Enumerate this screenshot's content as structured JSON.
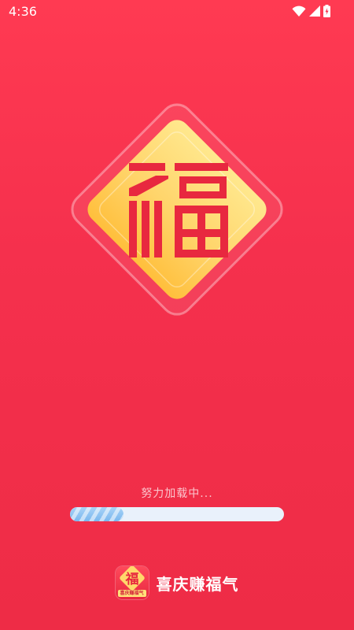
{
  "status_bar": {
    "time": "4:36",
    "icons": [
      "wifi-icon",
      "cell-signal-icon",
      "battery-icon"
    ]
  },
  "emblem": {
    "character": "福"
  },
  "loading": {
    "text": "努力加载中...",
    "progress_fraction": 0.25
  },
  "brand": {
    "app_name": "喜庆赚福气",
    "icon_char": "福",
    "icon_label": "喜庆赚福气"
  },
  "colors": {
    "background": "#f5304d",
    "emblem_gold": "#ffd86b",
    "emblem_red": "#e8283f",
    "progress_fill": "#8ec4f2",
    "progress_track": "#e9f1fb"
  }
}
